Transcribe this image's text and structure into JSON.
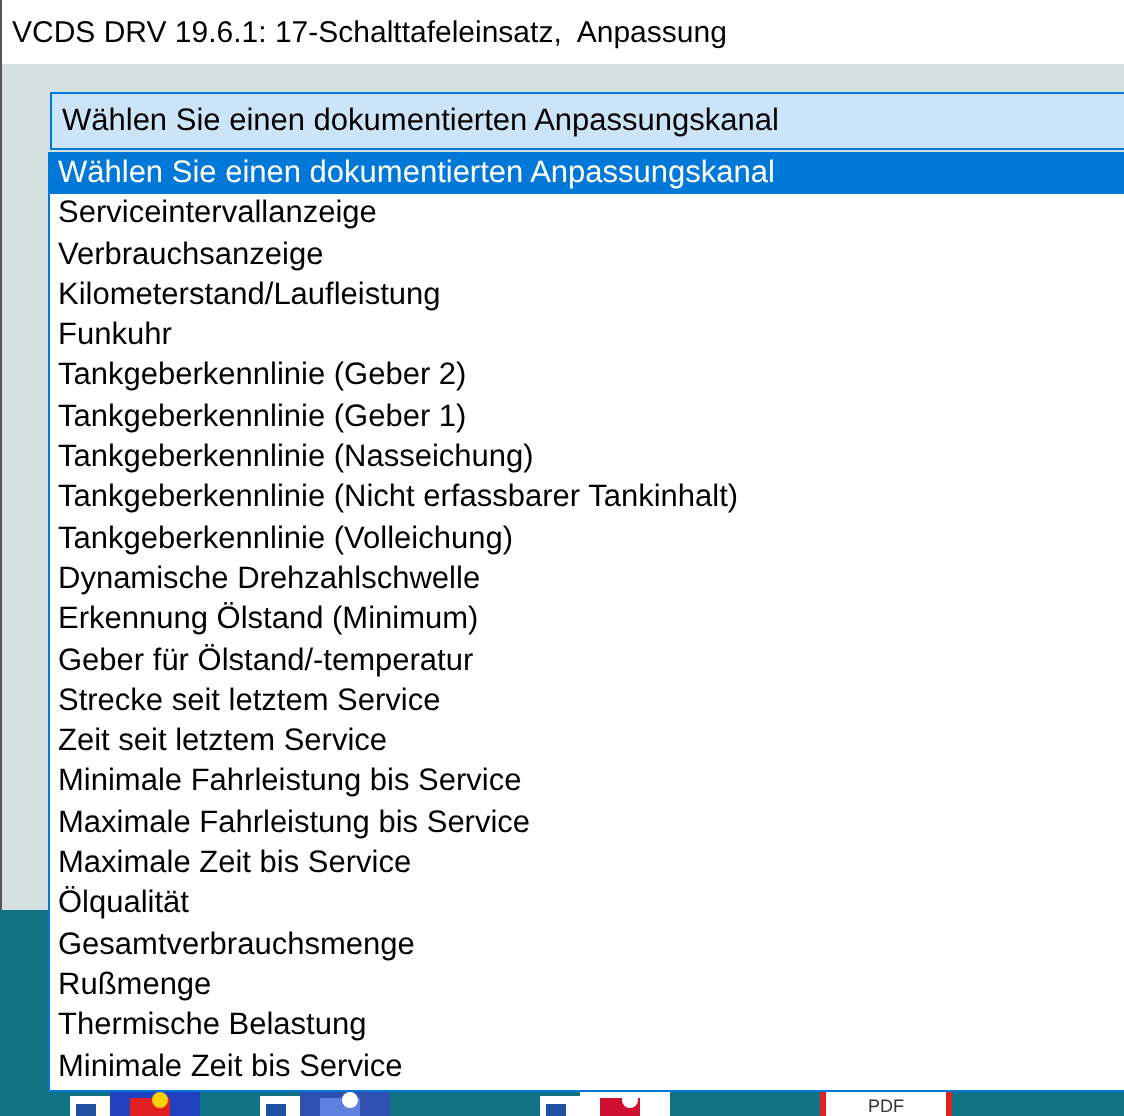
{
  "window": {
    "title": "VCDS DRV 19.6.1: 17-Schalttafeleinsatz,  Anpassung"
  },
  "combo": {
    "value": "Wählen Sie einen dokumentierten Anpassungskanal"
  },
  "dropdown": {
    "items": [
      {
        "label": "Wählen Sie einen dokumentierten Anpassungskanal",
        "selected": true
      },
      {
        "label": "Serviceintervallanzeige",
        "selected": false
      },
      {
        "label": "Verbrauchsanzeige",
        "selected": false
      },
      {
        "label": "Kilometerstand/Laufleistung",
        "selected": false
      },
      {
        "label": "Funkuhr",
        "selected": false
      },
      {
        "label": "Tankgeberkennlinie (Geber 2)",
        "selected": false
      },
      {
        "label": "Tankgeberkennlinie (Geber 1)",
        "selected": false
      },
      {
        "label": "Tankgeberkennlinie (Nasseichung)",
        "selected": false
      },
      {
        "label": "Tankgeberkennlinie (Nicht erfassbarer Tankinhalt)",
        "selected": false
      },
      {
        "label": "Tankgeberkennlinie (Volleichung)",
        "selected": false
      },
      {
        "label": "Dynamische Drehzahlschwelle",
        "selected": false
      },
      {
        "label": "Erkennung Ölstand (Minimum)",
        "selected": false
      },
      {
        "label": "Geber für Ölstand/-temperatur",
        "selected": false
      },
      {
        "label": "Strecke seit letztem Service",
        "selected": false
      },
      {
        "label": "Zeit seit letztem Service",
        "selected": false
      },
      {
        "label": "Minimale Fahrleistung bis Service",
        "selected": false
      },
      {
        "label": "Maximale Fahrleistung bis Service",
        "selected": false
      },
      {
        "label": "Maximale Zeit bis Service",
        "selected": false
      },
      {
        "label": "Ölqualität",
        "selected": false
      },
      {
        "label": "Gesamtverbrauchsmenge",
        "selected": false
      },
      {
        "label": "Rußmenge",
        "selected": false
      },
      {
        "label": "Thermische Belastung",
        "selected": false
      },
      {
        "label": "Minimale Zeit bis Service",
        "selected": false
      }
    ]
  },
  "desktop": {
    "icons": [
      {
        "kind": "app"
      },
      {
        "kind": "app"
      },
      {
        "kind": "app"
      },
      {
        "kind": "pdf",
        "label": "PDF"
      }
    ]
  }
}
